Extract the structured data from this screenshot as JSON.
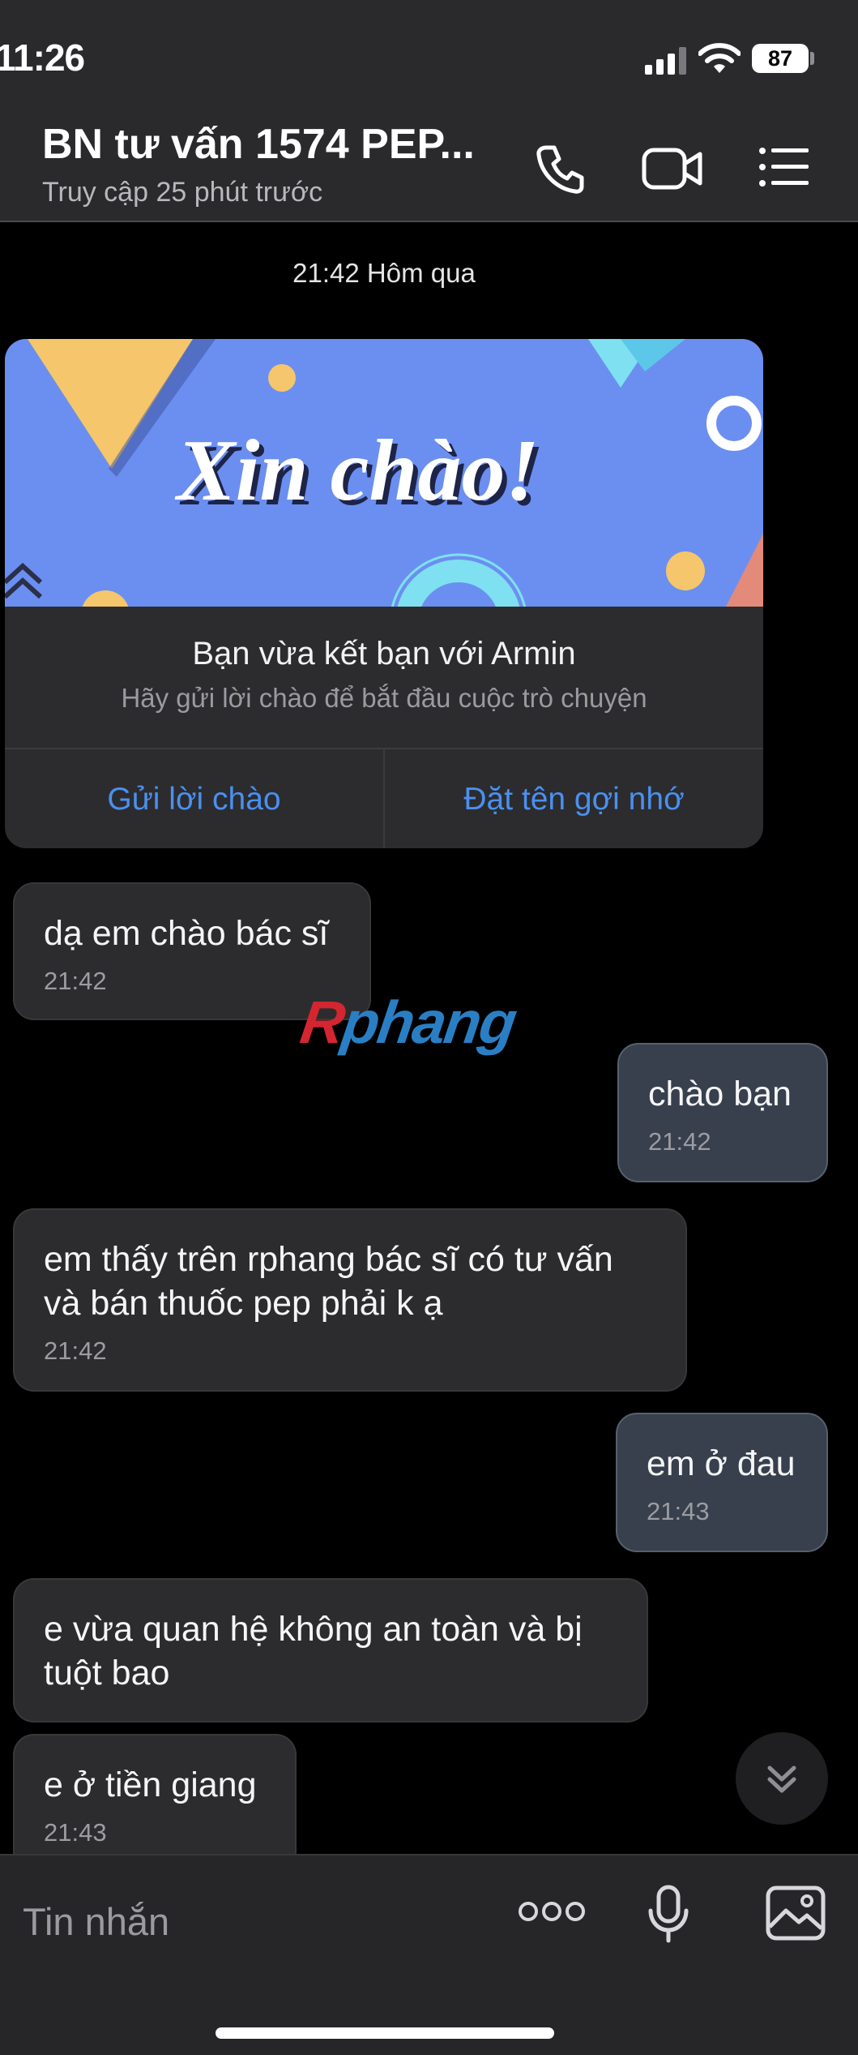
{
  "status_bar": {
    "time": "11:26",
    "battery": "87"
  },
  "header": {
    "title": "BN tư vấn 1574 PEP...",
    "subtitle": "Truy cập 25 phút trước",
    "icons": [
      "phone-icon",
      "video-call-icon",
      "menu-list-icon"
    ]
  },
  "time_separator": "21:42 Hôm qua",
  "welcome_card": {
    "banner_text": "Xin chào!",
    "title": "Bạn vừa kết bạn với Armin",
    "subtitle": "Hãy gửi lời chào để bắt đầu cuộc trò chuyện",
    "action_greet": "Gửi lời chào",
    "action_nickname": "Đặt tên gợi nhớ"
  },
  "watermark": {
    "prefix": "R",
    "rest": "phang"
  },
  "messages": [
    {
      "direction": "in",
      "text": "dạ em chào bác sĩ",
      "time": "21:42"
    },
    {
      "direction": "out",
      "text": "chào bạn",
      "time": "21:42"
    },
    {
      "direction": "in",
      "text": "em thấy trên rphang bác sĩ có tư vấn và bán thuốc pep phải k ạ",
      "time": "21:42"
    },
    {
      "direction": "out",
      "text": "em ở đau",
      "time": "21:43"
    },
    {
      "direction": "in",
      "text": "e vừa quan hệ không an toàn và bị tuột bao",
      "time": ""
    },
    {
      "direction": "in",
      "text": "e ở tiền giang",
      "time": "21:43"
    }
  ],
  "composer": {
    "placeholder": "Tin nhắn",
    "icons": [
      "more-icon",
      "microphone-icon",
      "image-icon"
    ]
  },
  "colors": {
    "background": "#000000",
    "incoming_bubble": "#2c2c2e",
    "outgoing_bubble": "#37404c",
    "link": "#4a90f0",
    "banner": "#6b8ff0"
  }
}
